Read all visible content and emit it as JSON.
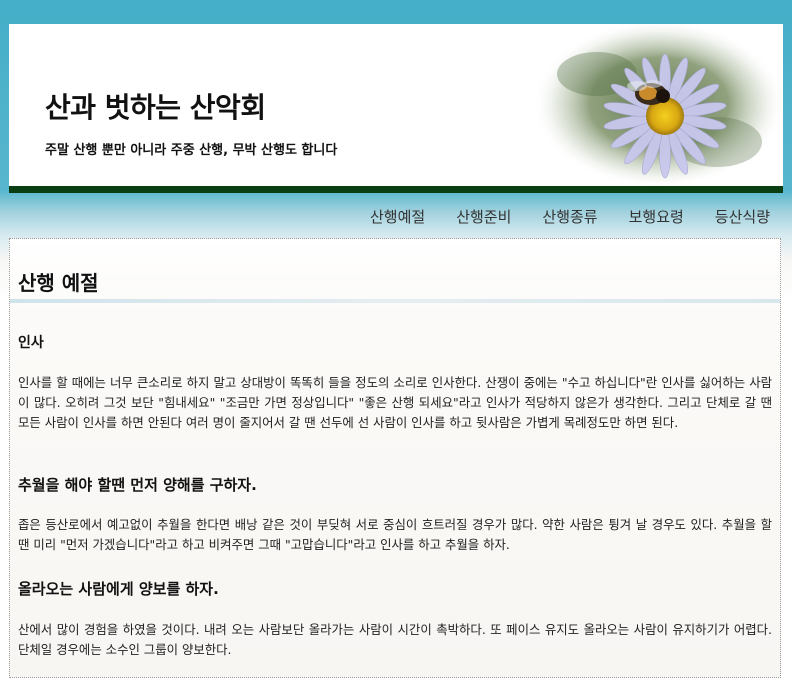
{
  "header": {
    "title": "산과 벗하는 산악회",
    "subtitle": "주말 산행 뿐만 아니라 주중 산행, 무박 산행도 합니다"
  },
  "nav": {
    "items": [
      "산행예절",
      "산행준비",
      "산행종류",
      "보행요령",
      "등산식량"
    ]
  },
  "main": {
    "title": "산행 예절",
    "sections": [
      {
        "heading": "인사",
        "text": "인사를 할 때에는 너무 큰소리로 하지 말고 상대방이 똑똑히 들을 정도의 소리로 인사한다. 산쟁이 중에는 \"수고 하십니다\"란 인사를 싫어하는 사람이 많다. 오히려 그것 보단 \"힘내세요\" \"조금만 가면 정상입니다\" \"좋은 산행 되세요\"라고 인사가 적당하지 않은가 생각한다. 그리고 단체로 갈 땐 모든 사람이 인사를 하면 안된다 여러 명이 줄지어서 갈 땐 선두에 선 사람이 인사를 하고 뒷사람은 가볍게 목례정도만 하면 된다."
      },
      {
        "heading": "추월을 해야 할땐 먼저 양해를 구하자.",
        "text": "좁은 등산로에서 예고없이 추월을 한다면 배낭 같은 것이 부딪혀 서로 중심이 흐트러질 경우가 많다. 약한 사람은 튕겨 날 경우도 있다. 추월을 할 땐 미리 \"먼저 가겠습니다\"라고 하고 비켜주면 그때 \"고맙습니다\"라고 인사를 하고 추월을 하자."
      },
      {
        "heading": "올라오는 사람에게 양보를 하자.",
        "text": "산에서 많이 경험을 하였을 것이다. 내려 오는 사람보단 올라가는 사람이 시간이 촉박하다. 또 페이스 유지도 올라오는 사람이 유지하기가 어렵다. 단체일 경우에는 소수인 그룹이 양보한다."
      }
    ]
  },
  "icons": {
    "banner_image": "daisy-with-bee-image"
  },
  "colors": {
    "header_bar": "#0b3d12",
    "sky": "#44aec8"
  }
}
